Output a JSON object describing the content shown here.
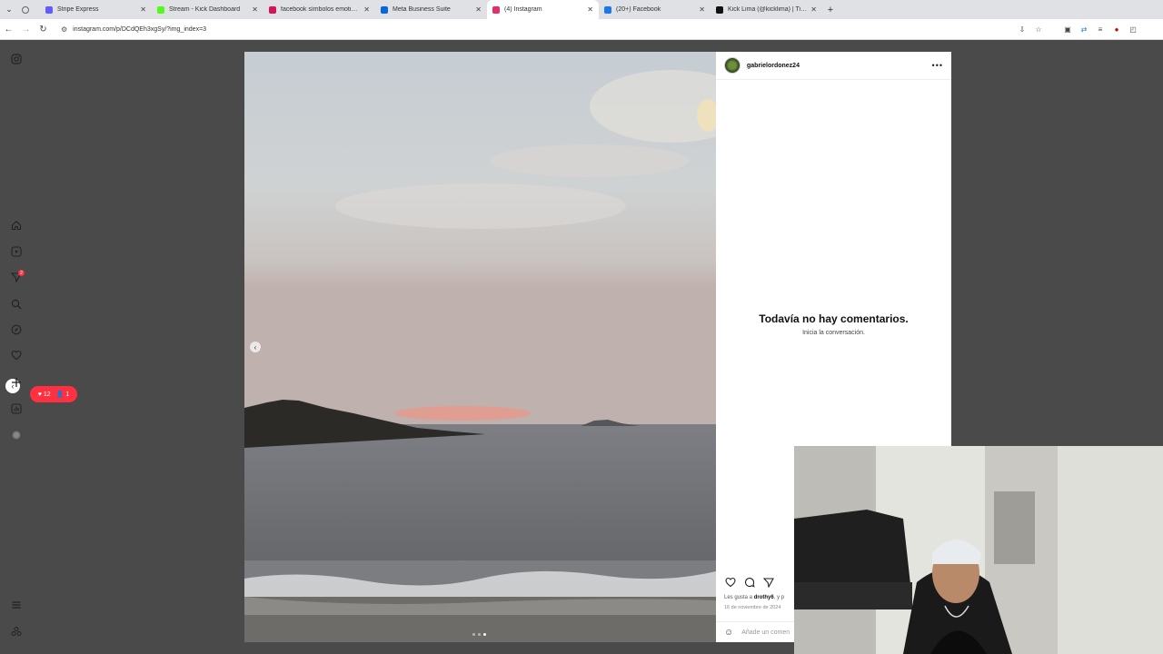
{
  "browser": {
    "tabs": [
      {
        "title": "Stripe Express",
        "color": "#635bff",
        "active": false
      },
      {
        "title": "Stream - Kick Dashboard",
        "color": "#53fc18",
        "active": false
      },
      {
        "title": "facebook símbolos emoticonos",
        "color": "#d4145a",
        "active": false
      },
      {
        "title": "Meta Business Suite",
        "color": "#0668e1",
        "active": false
      },
      {
        "title": "(4) Instagram",
        "color": "#e1306c",
        "active": true
      },
      {
        "title": "(20+) Facebook",
        "color": "#1877f2",
        "active": false
      },
      {
        "title": "Kick Lima (@kicklima) | TikTok",
        "color": "#111111",
        "active": false
      }
    ],
    "url": "instagram.com/p/DCdQEh3xgSy/?img_index=3"
  },
  "sidebar": {
    "notifications_badge": "2",
    "pill": {
      "likes": "12",
      "followers": "1"
    }
  },
  "post": {
    "username": "gabrielordonez24",
    "no_comments_title": "Todavía no hay comentarios.",
    "no_comments_sub": "Inicia la conversación.",
    "likes_prefix": "Les gusta a",
    "likes_user": "drothy6",
    "likes_suffix": "y p",
    "date": "16 de noviembre de 2024",
    "comment_placeholder": "Añade un comen",
    "carousel": {
      "total": 3,
      "current": 3
    }
  }
}
